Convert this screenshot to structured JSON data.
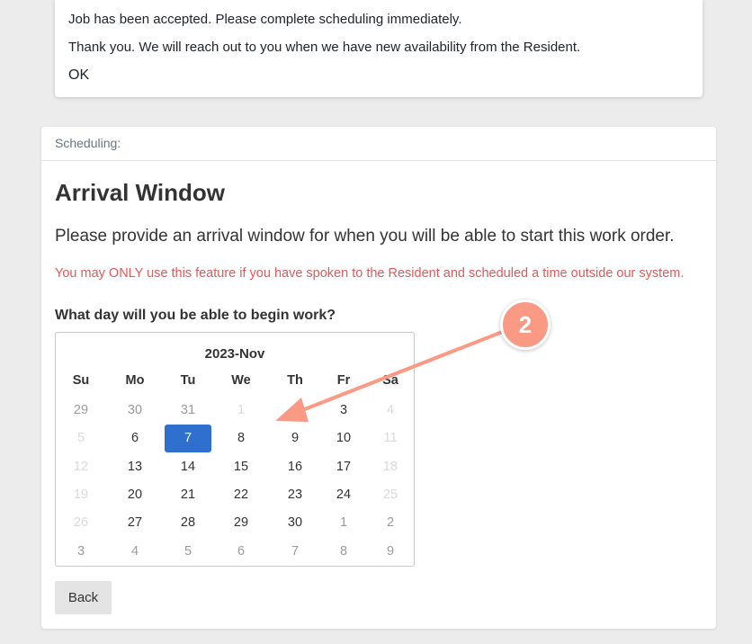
{
  "message_card": {
    "line1": "Job has been accepted. Please complete scheduling immediately.",
    "line2": "Thank you. We will reach out to you when we have new availability from the Resident.",
    "ok_label": "OK"
  },
  "scheduling": {
    "header": "Scheduling:",
    "title": "Arrival Window",
    "prompt": "Please provide an arrival window for when you will be able to start this work order.",
    "warning": "You may ONLY use this feature if you have spoken to the Resident and scheduled a time outside our system.",
    "warning_color": "#e05a5a",
    "question": "What day will you be able to begin work?",
    "back_label": "Back"
  },
  "calendar": {
    "title": "2023-Nov",
    "selected_color": "#2f6fce",
    "weekdays": [
      "Su",
      "Mo",
      "Tu",
      "We",
      "Th",
      "Fr",
      "Sa"
    ],
    "weeks": [
      [
        {
          "d": "29",
          "s": "muted"
        },
        {
          "d": "30",
          "s": "muted"
        },
        {
          "d": "31",
          "s": "muted"
        },
        {
          "d": "1",
          "s": "disabled"
        },
        {
          "d": "2",
          "s": "disabled"
        },
        {
          "d": "3",
          "s": "normal"
        },
        {
          "d": "4",
          "s": "disabled"
        }
      ],
      [
        {
          "d": "5",
          "s": "disabled"
        },
        {
          "d": "6",
          "s": "normal"
        },
        {
          "d": "7",
          "s": "selected"
        },
        {
          "d": "8",
          "s": "normal"
        },
        {
          "d": "9",
          "s": "normal"
        },
        {
          "d": "10",
          "s": "normal"
        },
        {
          "d": "11",
          "s": "disabled"
        }
      ],
      [
        {
          "d": "12",
          "s": "disabled"
        },
        {
          "d": "13",
          "s": "normal"
        },
        {
          "d": "14",
          "s": "normal"
        },
        {
          "d": "15",
          "s": "normal"
        },
        {
          "d": "16",
          "s": "normal"
        },
        {
          "d": "17",
          "s": "normal"
        },
        {
          "d": "18",
          "s": "disabled"
        }
      ],
      [
        {
          "d": "19",
          "s": "disabled"
        },
        {
          "d": "20",
          "s": "normal"
        },
        {
          "d": "21",
          "s": "normal"
        },
        {
          "d": "22",
          "s": "normal"
        },
        {
          "d": "23",
          "s": "normal"
        },
        {
          "d": "24",
          "s": "normal"
        },
        {
          "d": "25",
          "s": "disabled"
        }
      ],
      [
        {
          "d": "26",
          "s": "disabled"
        },
        {
          "d": "27",
          "s": "normal"
        },
        {
          "d": "28",
          "s": "normal"
        },
        {
          "d": "29",
          "s": "normal"
        },
        {
          "d": "30",
          "s": "normal"
        },
        {
          "d": "1",
          "s": "muted"
        },
        {
          "d": "2",
          "s": "muted"
        }
      ],
      [
        {
          "d": "3",
          "s": "muted"
        },
        {
          "d": "4",
          "s": "muted"
        },
        {
          "d": "5",
          "s": "muted"
        },
        {
          "d": "6",
          "s": "muted"
        },
        {
          "d": "7",
          "s": "muted"
        },
        {
          "d": "8",
          "s": "muted"
        },
        {
          "d": "9",
          "s": "muted"
        }
      ]
    ]
  },
  "annotation": {
    "step_number": "2",
    "color": "#fa9a84"
  }
}
